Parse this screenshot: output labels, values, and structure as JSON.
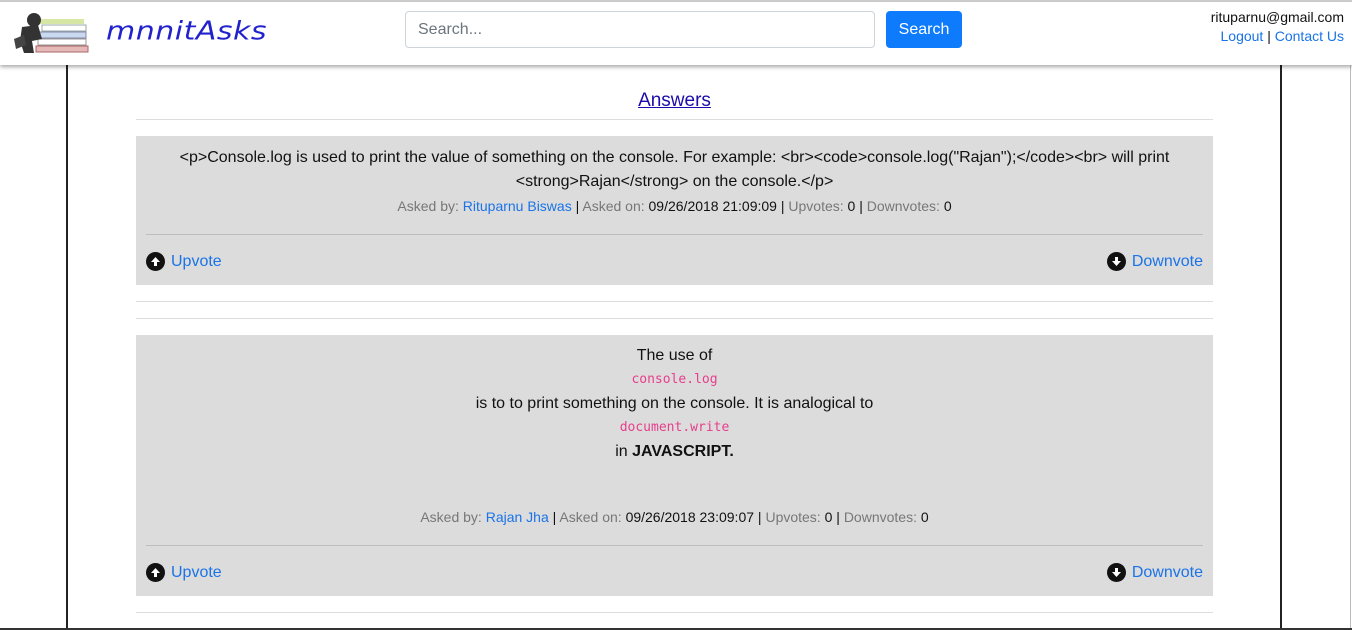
{
  "header": {
    "brand": "mnnitAsks",
    "search_placeholder": "Search...",
    "search_button": "Search",
    "user_email": "rituparnu@gmail.com",
    "logout_label": "Logout",
    "separator": "|",
    "contact_label": "Contact Us"
  },
  "main": {
    "title": "Answers",
    "answers": [
      {
        "body_line1": "<p>Console.log is used to print the value of something on the console. For example: <br><code>console.log(\"Rajan\");</code><br> will print",
        "body_line2": "<strong>Rajan</strong> on the console.</p>",
        "asked_by_label": "Asked by:",
        "author": "Rituparnu Biswas",
        "asked_on_label": "Asked on:",
        "date": "09/26/2018 21:09:09",
        "upvotes_label": "Upvotes:",
        "upvotes": "0",
        "downvotes_label": "Downvotes:",
        "downvotes": "0",
        "upvote_label": "Upvote",
        "downvote_label": "Downvote"
      },
      {
        "body_line1": "The use of",
        "code1": "console.log",
        "body_line2": "is to to print something on the console. It is analogical to",
        "code2": "document.write",
        "body_line3_prefix": "in",
        "body_line3_bold": "JAVASCRIPT.",
        "asked_by_label": "Asked by:",
        "author": "Rajan Jha",
        "asked_on_label": "Asked on:",
        "date": "09/26/2018 23:09:07",
        "upvotes_label": "Upvotes:",
        "upvotes": "0",
        "downvotes_label": "Downvotes:",
        "downvotes": "0",
        "upvote_label": "Upvote",
        "downvote_label": "Downvote"
      }
    ]
  }
}
